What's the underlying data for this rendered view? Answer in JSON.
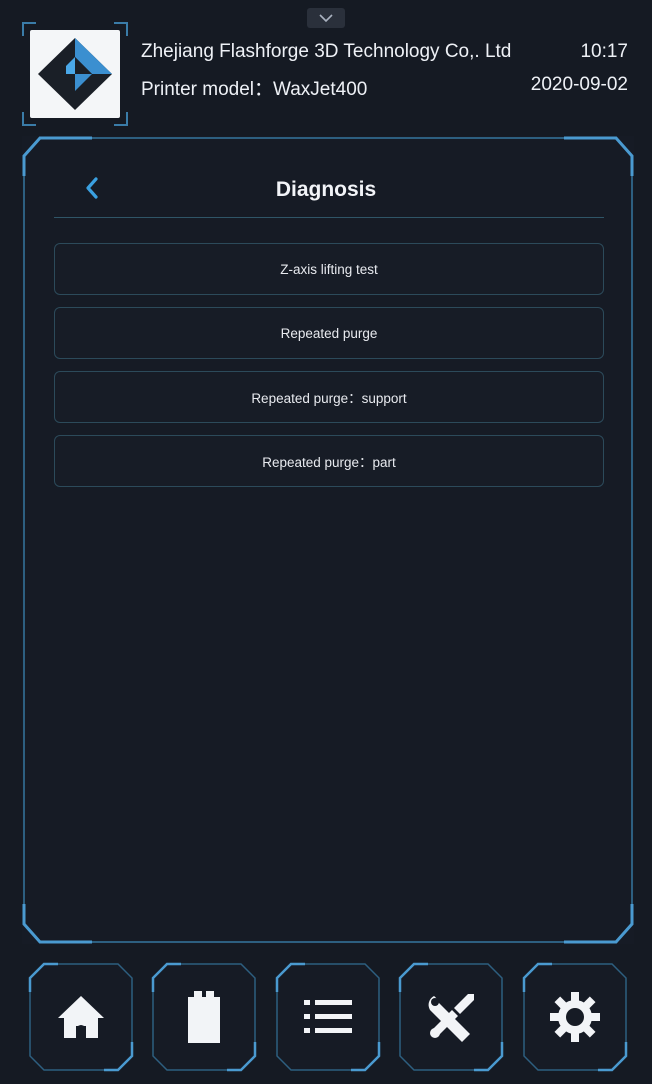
{
  "header": {
    "company": "Zhejiang Flashforge 3D Technology Co,. Ltd",
    "printer_model": "Printer model：WaxJet400",
    "time": "10:17",
    "date": "2020-09-02"
  },
  "page": {
    "title": "Diagnosis"
  },
  "menu": {
    "items": [
      {
        "label": "Z-axis lifting test"
      },
      {
        "label": "Repeated purge"
      },
      {
        "label": "Repeated purge：support"
      },
      {
        "label": "Repeated purge：part"
      }
    ]
  },
  "nav": {
    "items": [
      {
        "icon": "home-icon"
      },
      {
        "icon": "file-icon"
      },
      {
        "icon": "list-icon"
      },
      {
        "icon": "tools-icon"
      },
      {
        "icon": "gear-icon"
      }
    ]
  },
  "colors": {
    "background": "#151a23",
    "frame": "#3a7ca8",
    "accent": "#3aa0e0",
    "text": "#eef1f6"
  }
}
